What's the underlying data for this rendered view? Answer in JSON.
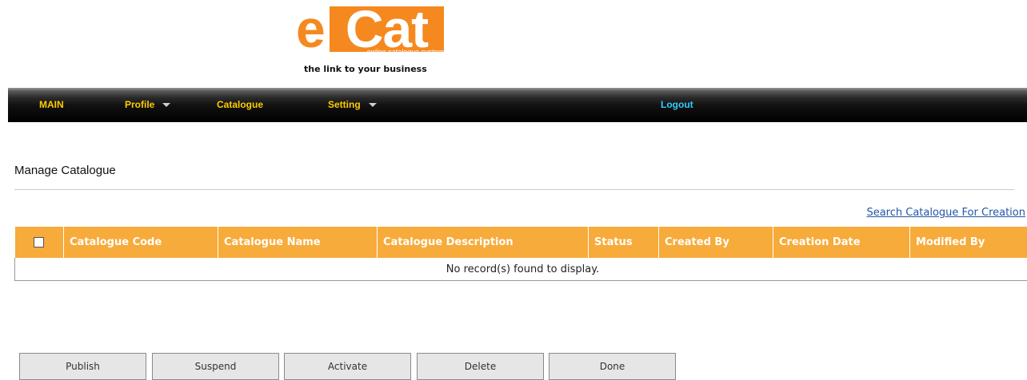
{
  "logo": {
    "e": "e",
    "cat": "Cat",
    "subtitle": "online catalogue system",
    "tagline": "the link to your business"
  },
  "nav": {
    "main": "MAIN",
    "profile": "Profile",
    "catalogue": "Catalogue",
    "setting": "Setting",
    "logout": "Logout"
  },
  "page": {
    "title": "Manage Catalogue",
    "search_link": "Search Catalogue For Creation"
  },
  "table": {
    "columns": [
      "Catalogue Code",
      "Catalogue Name",
      "Catalogue Description",
      "Status",
      "Created By",
      "Creation Date",
      "Modified By"
    ],
    "empty_message": "No record(s) found to display."
  },
  "buttons": {
    "publish": "Publish",
    "suspend": "Suspend",
    "activate": "Activate",
    "delete": "Delete",
    "done": "Done"
  },
  "colors": {
    "brand_orange": "#f5891f",
    "header_orange": "#f7ab3a",
    "nav_text": "#ffcc00",
    "logout_text": "#33ccff",
    "link": "#2255aa"
  }
}
